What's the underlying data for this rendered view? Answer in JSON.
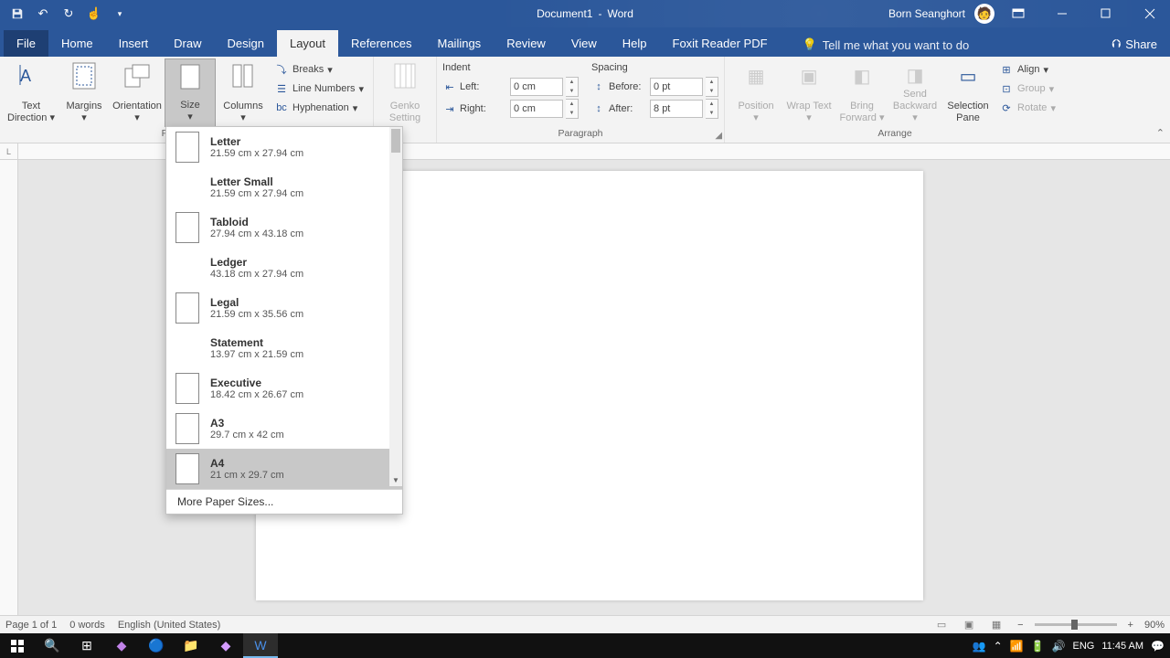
{
  "title": {
    "doc": "Document1",
    "sep": "-",
    "app": "Word"
  },
  "user": "Born Seanghort",
  "tabs": [
    "File",
    "Home",
    "Insert",
    "Draw",
    "Design",
    "Layout",
    "References",
    "Mailings",
    "Review",
    "View",
    "Help",
    "Foxit Reader PDF"
  ],
  "active_tab": "Layout",
  "tell_me": "Tell me what you want to do",
  "share": "Share",
  "ribbon": {
    "page_setup": {
      "label": "Page Setup",
      "text_direction": "Text Direction",
      "margins": "Margins",
      "orientation": "Orientation",
      "size": "Size",
      "columns": "Columns",
      "breaks": "Breaks",
      "line_numbers": "Line Numbers",
      "hyphenation": "Hyphenation"
    },
    "genko": {
      "label": "Genko Setting"
    },
    "paragraph": {
      "label": "Paragraph",
      "indent": "Indent",
      "left": "Left:",
      "right": "Right:",
      "left_val": "0 cm",
      "right_val": "0 cm",
      "spacing": "Spacing",
      "before": "Before:",
      "after": "After:",
      "before_val": "0 pt",
      "after_val": "8 pt"
    },
    "arrange": {
      "label": "Arrange",
      "position": "Position",
      "wrap": "Wrap Text",
      "bring": "Bring Forward",
      "send": "Send Backward",
      "selection": "Selection Pane",
      "align": "Align",
      "group": "Group",
      "rotate": "Rotate"
    }
  },
  "size_menu": {
    "items": [
      {
        "name": "Letter",
        "dim": "21.59 cm x 27.94 cm",
        "icon": true
      },
      {
        "name": "Letter Small",
        "dim": "21.59 cm x 27.94 cm",
        "icon": false
      },
      {
        "name": "Tabloid",
        "dim": "27.94 cm x 43.18 cm",
        "icon": true
      },
      {
        "name": "Ledger",
        "dim": "43.18 cm x 27.94 cm",
        "icon": false
      },
      {
        "name": "Legal",
        "dim": "21.59 cm x 35.56 cm",
        "icon": true
      },
      {
        "name": "Statement",
        "dim": "13.97 cm x 21.59 cm",
        "icon": false
      },
      {
        "name": "Executive",
        "dim": "18.42 cm x 26.67 cm",
        "icon": true
      },
      {
        "name": "A3",
        "dim": "29.7 cm x 42 cm",
        "icon": true
      },
      {
        "name": "A4",
        "dim": "21 cm x 29.7 cm",
        "icon": true
      }
    ],
    "selected": "A4",
    "more": "More Paper Sizes..."
  },
  "status": {
    "page": "Page 1 of 1",
    "words": "0 words",
    "lang": "English (United States)",
    "zoom": "90%"
  },
  "tray": {
    "lang": "ENG",
    "time": "11:45 AM"
  }
}
